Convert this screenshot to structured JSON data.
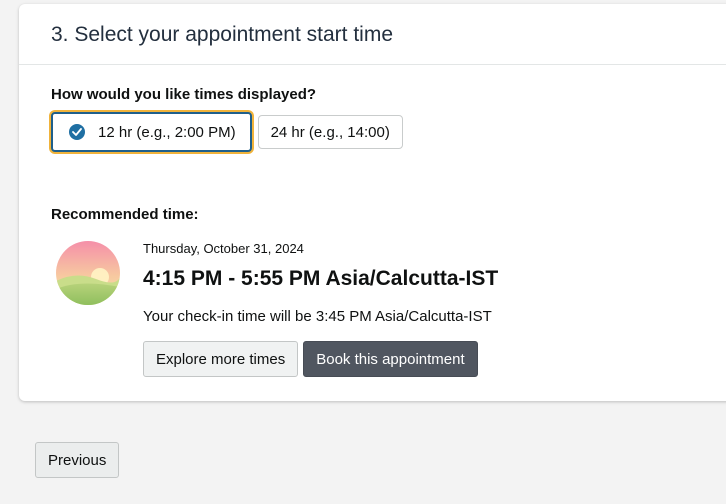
{
  "section": {
    "title": "3. Select your appointment start time"
  },
  "time_format": {
    "question": "How would you like times displayed?",
    "options": [
      {
        "label": "12 hr (e.g., 2:00 PM)",
        "selected": true
      },
      {
        "label": "24 hr (e.g., 14:00)",
        "selected": false
      }
    ]
  },
  "recommendation": {
    "label": "Recommended time:",
    "icon": "sunrise-icon",
    "date": "Thursday, October 31, 2024",
    "time_range": "4:15 PM - 5:55 PM Asia/Calcutta-IST",
    "checkin": "Your check-in time will be 3:45 PM Asia/Calcutta-IST",
    "explore_label": "Explore more times",
    "book_label": "Book this appointment"
  },
  "footer": {
    "previous_label": "Previous"
  },
  "colors": {
    "selected_border": "#1f5f8b",
    "focus_ring": "#f0b33b",
    "primary_button": "#505660",
    "check_icon": "#1f6fa3"
  }
}
